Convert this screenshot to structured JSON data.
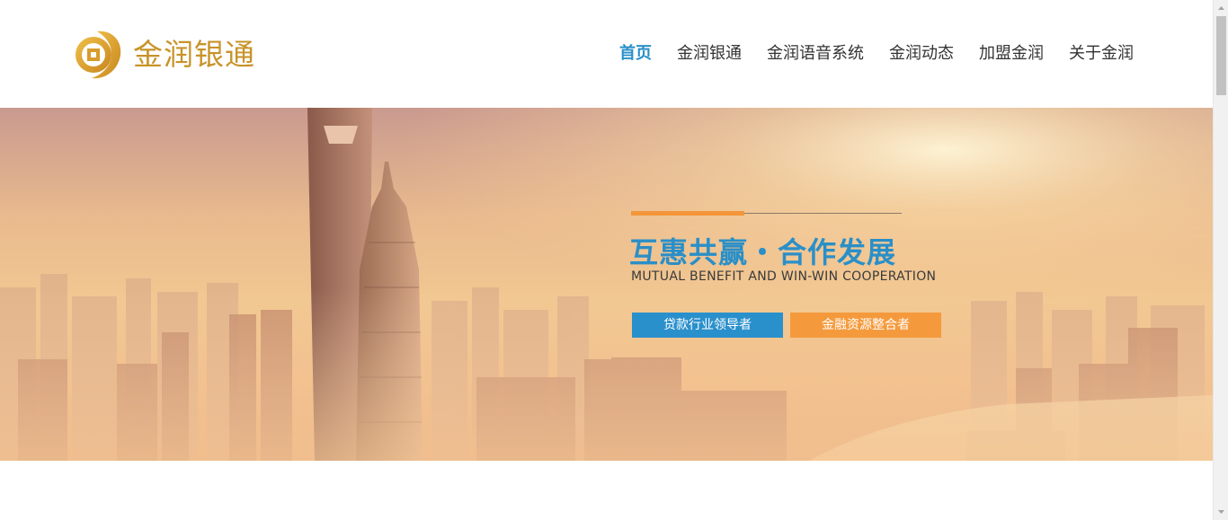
{
  "header": {
    "logo_text": "金润银通",
    "nav": [
      {
        "label": "首页",
        "active": true
      },
      {
        "label": "金润银通",
        "active": false
      },
      {
        "label": "金润语音系统",
        "active": false
      },
      {
        "label": "金润动态",
        "active": false
      },
      {
        "label": "加盟金润",
        "active": false
      },
      {
        "label": "关于金润",
        "active": false
      }
    ]
  },
  "banner": {
    "slogan": "互惠共赢・合作发展",
    "slogan_en": "MUTUAL BENEFIT AND WIN-WIN COOPERATION",
    "button_blue": "贷款行业领导者",
    "button_orange": "金融资源整合者"
  },
  "colors": {
    "accent_blue": "#2a8fc8",
    "accent_orange": "#f59a3c",
    "logo_gold": "#c8932a"
  }
}
